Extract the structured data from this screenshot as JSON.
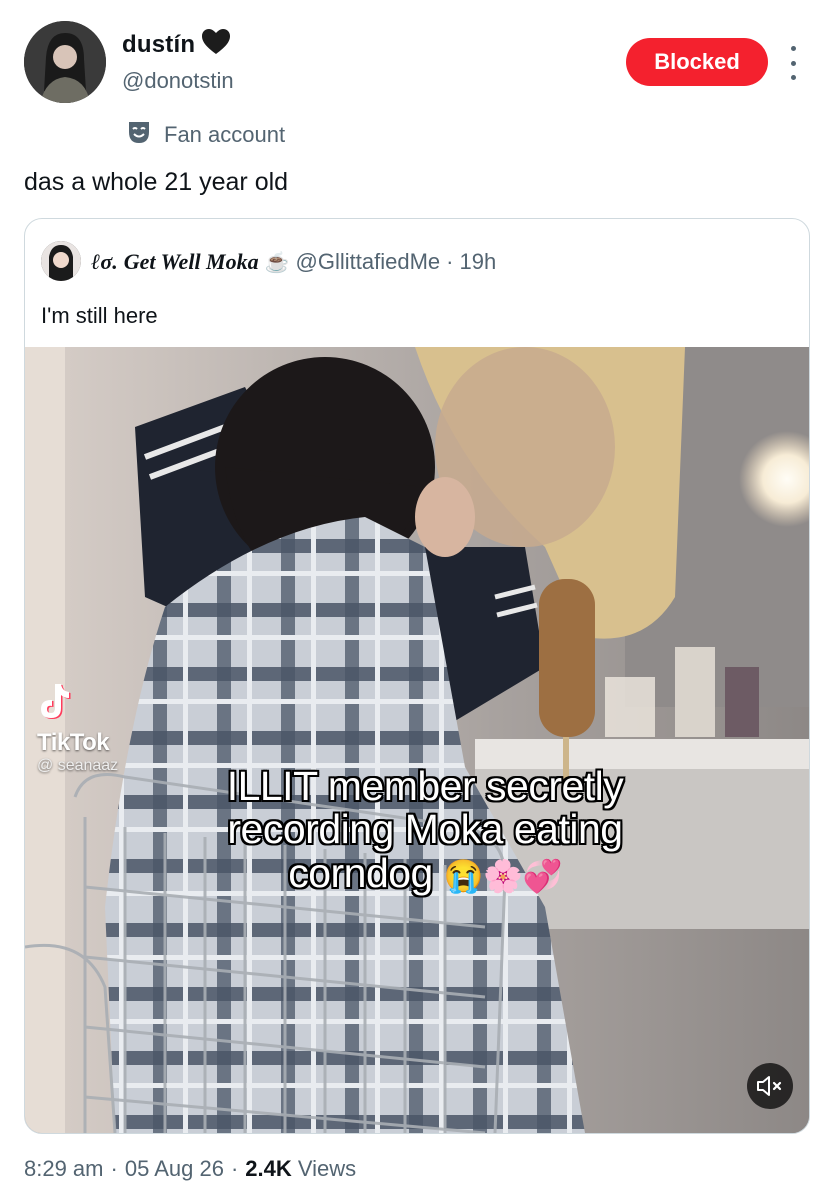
{
  "author": {
    "display_name": "dustín",
    "handle": "@donotstin",
    "label": "Fan account",
    "avatar_icon": "profile-photo",
    "name_emoji_icon": "black-heart-icon"
  },
  "actions": {
    "blocked_label": "Blocked",
    "more_icon": "more-dots-icon",
    "blocked_color": "#f4212e"
  },
  "tweet": {
    "text": "das a whole 21 year old"
  },
  "quoted": {
    "display_name_prefix": "ℓσ.",
    "display_name": "Get Well Moka",
    "name_emoji": "☕",
    "handle": "@GllittafiedMe",
    "separator": "·",
    "time": "19h",
    "text": "I'm still here",
    "media": {
      "watermark": "TikTok",
      "watermark_user": "@ seanaaz",
      "caption_line1": "ILLIT member secretly",
      "caption_line2": "recording Moka eating",
      "caption_line3": "corndog",
      "caption_emojis": "😭🌸💞",
      "mute_icon": "speaker-muted-icon"
    }
  },
  "footer": {
    "time": "8:29 am",
    "sep1": "·",
    "date": "05 Aug 26",
    "sep2": "·",
    "views_count": "2.4K",
    "views_label": "Views"
  }
}
